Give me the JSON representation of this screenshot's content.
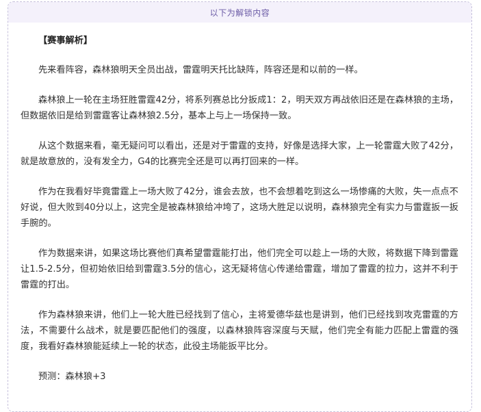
{
  "header": {
    "unlock_notice": "以下为解锁内容"
  },
  "article": {
    "section_title": "【赛事解析】",
    "paragraphs": [
      "先来看阵容，森林狼明天全员出战，雷霆明天托比缺阵，阵容还是和以前的一样。",
      "森林狼上一轮在主场狂胜雷霆42分，将系列赛总比分扳成1：2，明天双方再战依旧还是在森林狼的主场，但数据依旧是给到雷霆客让森林狼2.5分，基本上与上一场保持一致。",
      "从这个数据来看，毫无疑问可以看出，还是对于雷霆的支持，好像是选择大家，上一轮雷霆大败了42分，就是故意放的，没有发全力，G4的比赛完全还是可以再打回来的一样。",
      "作为在我看好毕竟雷霆上一场大败了42分，谁会去放，也不会想着吃到这么一场惨痛的大败，失一点点不好说，但大败到40分以上，这完全是被森林狼给冲垮了，这场大胜足以说明，森林狼完全有实力与雷霆扳一扳手腕的。",
      "作为数据来讲，如果这场比赛他们真希望雷霆能打出，他们完全可以趁上一场的大败，将数据下降到雷霆让1.5-2.5分，但初始依旧给到雷霆3.5分的信心，这无疑将信心传递给雷霆，增加了雷霆的拉力，这并不利于雷霆的打出。",
      "作为森林狼来讲，他们上一轮大胜已经找到了信心，主将爱德华兹也是讲到，他们已经找到攻克雷霆的方法，不需要什么战术，就是要匹配他们的强度，以森林狼阵容深度与天赋，他们完全有能力匹配上雷霆的强度，我看好森林狼能延续上一轮的状态，此役主场能扳平比分。",
      "预测：森林狼+3"
    ]
  }
}
